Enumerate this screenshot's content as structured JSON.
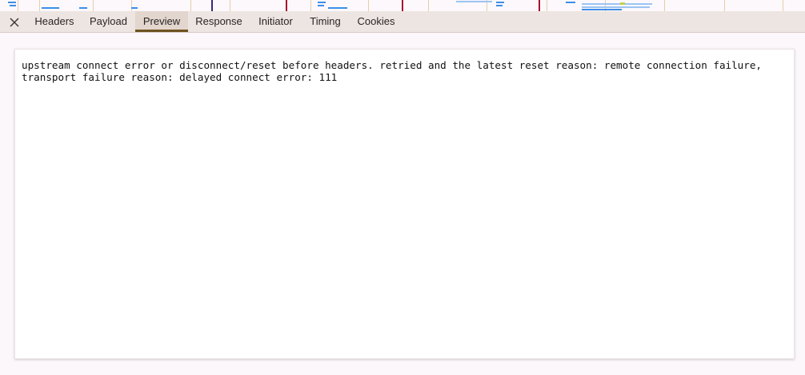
{
  "tabs": {
    "close_label": "✕",
    "items": [
      {
        "key": "headers",
        "label": "Headers"
      },
      {
        "key": "payload",
        "label": "Payload"
      },
      {
        "key": "preview",
        "label": "Preview"
      },
      {
        "key": "response",
        "label": "Response"
      },
      {
        "key": "initiator",
        "label": "Initiator"
      },
      {
        "key": "timing",
        "label": "Timing"
      },
      {
        "key": "cookies",
        "label": "Cookies"
      }
    ],
    "active": "Preview"
  },
  "preview": {
    "lines": [
      "upstream connect error or disconnect/reset before headers. retried and the latest reset reason: remote connection failure,",
      "transport failure reason: delayed connect error: 111"
    ]
  },
  "colors": {
    "tabbar_bg": "#ede5e1",
    "active_tab_bg": "#e2d6ce",
    "active_tab_underline": "#6d5220",
    "page_bg": "#fbf7fb"
  },
  "icons": {
    "close": "close-icon"
  }
}
